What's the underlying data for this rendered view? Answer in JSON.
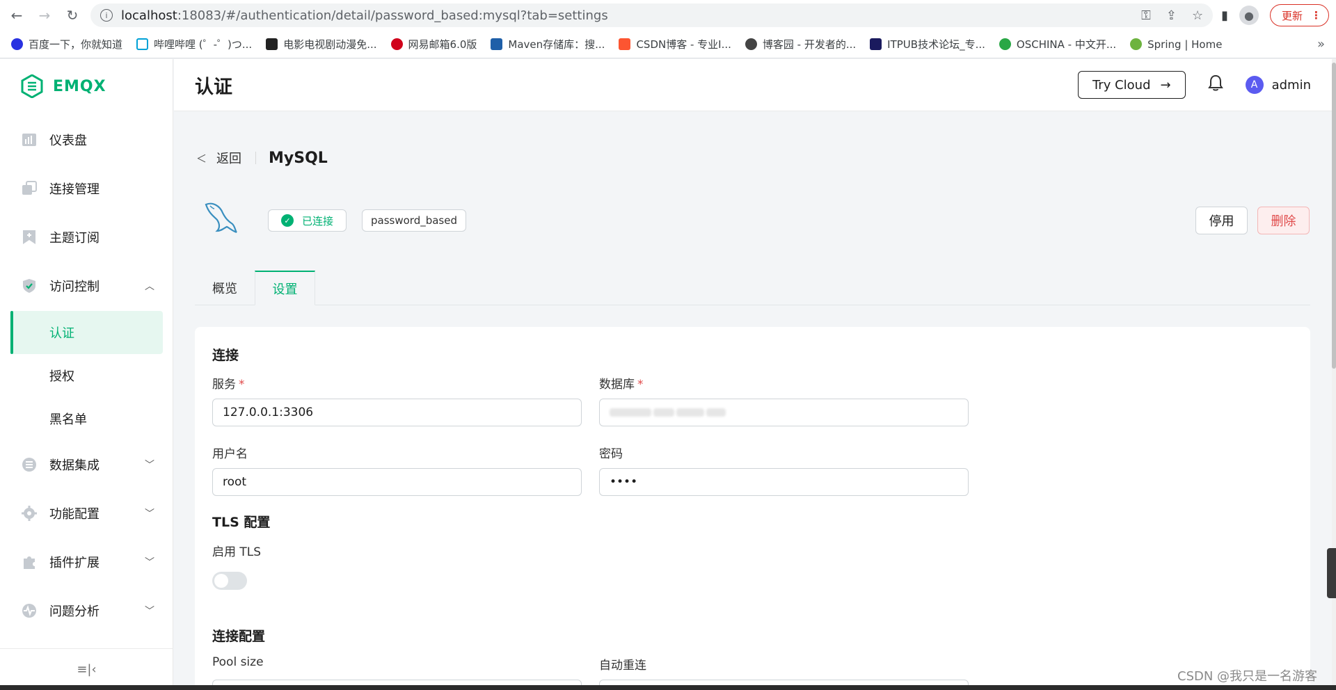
{
  "browser": {
    "url_host": "localhost",
    "url_rest": ":18083/#/authentication/detail/password_based:mysql?tab=settings",
    "update_label": "更新",
    "bookmarks": [
      {
        "label": "百度一下，你就知道",
        "color": "#2932e1"
      },
      {
        "label": "哔哩哔哩 (゜-゜)つ...",
        "color": "#00a1d6"
      },
      {
        "label": "电影电视剧动漫免...",
        "color": "#222222"
      },
      {
        "label": "网易邮箱6.0版",
        "color": "#d0021b"
      },
      {
        "label": "Maven存储库：搜...",
        "color": "#1f5fa8"
      },
      {
        "label": "CSDN博客 - 专业I...",
        "color": "#fc5531"
      },
      {
        "label": "博客园 - 开发者的...",
        "color": "#444444"
      },
      {
        "label": "ITPUB技术论坛_专...",
        "color": "#1a1a5e"
      },
      {
        "label": "OSCHINA - 中文开...",
        "color": "#29a745"
      },
      {
        "label": "Spring | Home",
        "color": "#6db33f"
      }
    ]
  },
  "brand": {
    "name": "EMQX",
    "color": "#00b173"
  },
  "sidebar": {
    "items": [
      {
        "label": "仪表盘",
        "icon": "dashboard-icon"
      },
      {
        "label": "连接管理",
        "icon": "connections-icon"
      },
      {
        "label": "主题订阅",
        "icon": "subscription-icon"
      },
      {
        "label": "访问控制",
        "icon": "shield-check-icon"
      },
      {
        "label": "数据集成",
        "icon": "database-icon"
      },
      {
        "label": "功能配置",
        "icon": "gear-icon"
      },
      {
        "label": "插件扩展",
        "icon": "puzzle-icon"
      },
      {
        "label": "问题分析",
        "icon": "diagnose-icon"
      }
    ],
    "sub_items": [
      {
        "label": "认证"
      },
      {
        "label": "授权"
      },
      {
        "label": "黑名单"
      }
    ],
    "collapse_glyph": "≡|‹"
  },
  "header": {
    "title": "认证",
    "try_cloud": "Try Cloud",
    "user": "admin",
    "avatar_letter": "A"
  },
  "detail": {
    "back_label": "返回",
    "title": "MySQL",
    "status": "已连接",
    "tag": "password_based",
    "disable_label": "停用",
    "delete_label": "删除"
  },
  "tabs": [
    {
      "label": "概览"
    },
    {
      "label": "设置"
    }
  ],
  "form": {
    "connection_title": "连接",
    "service_label": "服务",
    "service_value": "127.0.0.1:3306",
    "database_label": "数据库",
    "username_label": "用户名",
    "username_value": "root",
    "password_label": "密码",
    "password_value": "••••",
    "tls_title": "TLS 配置",
    "tls_enable_label": "启用 TLS",
    "tls_enabled": false,
    "conn_config_title": "连接配置",
    "pool_size_label": "Pool size",
    "auto_reconnect_label": "自动重连"
  },
  "watermark": "CSDN @我只是一名游客"
}
